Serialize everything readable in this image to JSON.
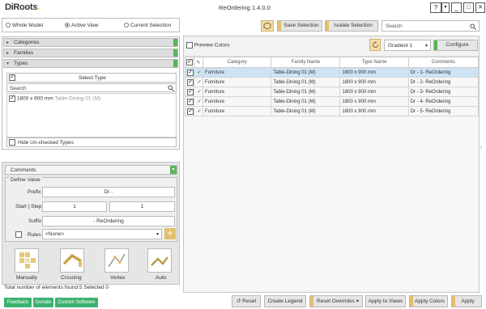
{
  "app": {
    "logo_main": "DiRoots",
    "logo_dot": ".",
    "title": "ReOrdering 1.4.0.0"
  },
  "window_buttons": {
    "help": "?",
    "menu": "▾",
    "minimize": "_",
    "maximize": "□",
    "close": "✕"
  },
  "scope": {
    "options": [
      "Whole Model",
      "Active View",
      "Current Selection"
    ],
    "selected": "Active View"
  },
  "toolbar": {
    "save_selection": "Save Selection",
    "isolate_selection": "Isolate Selection",
    "search_placeholder": "Search"
  },
  "filters": {
    "categories_label": "Categories",
    "families_label": "Families",
    "types_label": "Types",
    "select_type_label": "Select Type",
    "search_placeholder": "Search",
    "types": [
      {
        "name": "1800 x 900 mm",
        "family": "Table-Dining 01 (M)",
        "checked": true
      }
    ],
    "hide_unchecked_label": "Hide Un-checked Types"
  },
  "parameter": {
    "selected": "Comments",
    "define_value_label": "Define Value",
    "prefix_label": "Prefix",
    "prefix_value": "Dr -",
    "start_step_label": "Start | Step",
    "start_value": "1",
    "step_value": "1",
    "suffix_label": "Suffix",
    "suffix_value": "- ReOrdering",
    "rules_label": "Rules",
    "rules_value": "<None>",
    "add_rule": "+"
  },
  "modes": [
    {
      "label": "Manually"
    },
    {
      "label": "Crossing"
    },
    {
      "label": "Vertex"
    },
    {
      "label": "Auto"
    }
  ],
  "preview": {
    "preview_colors_label": "Preview Colors",
    "gradient_value": "Gradient 1",
    "configure_label": "Configure"
  },
  "table": {
    "columns": [
      "Category",
      "Family Name",
      "Type Name",
      "Comments"
    ],
    "rows": [
      {
        "category": "Furniture",
        "family": "Table-Dining 01 (M)",
        "type": "1800 x 900 mm",
        "comments": "Dr - 1- ReOrdering",
        "selected": true
      },
      {
        "category": "Furniture",
        "family": "Table-Dining 01 (M)",
        "type": "1800 x 900 mm",
        "comments": "Dr - 2- ReOrdering",
        "selected": false
      },
      {
        "category": "Furniture",
        "family": "Table-Dining 01 (M)",
        "type": "1800 x 900 mm",
        "comments": "Dr - 3- ReOrdering",
        "selected": false
      },
      {
        "category": "Furniture",
        "family": "Table-Dining 01 (M)",
        "type": "1800 x 900 mm",
        "comments": "Dr - 4- ReOrdering",
        "selected": false
      },
      {
        "category": "Furniture",
        "family": "Table-Dining 01 (M)",
        "type": "1800 x 900 mm",
        "comments": "Dr - 5- ReOrdering",
        "selected": false
      }
    ]
  },
  "status": {
    "found_label": "Total number of elements found",
    "found_count": "5",
    "selected_label": "Selected",
    "selected_count": "0"
  },
  "footer": {
    "feedback": "Feedback",
    "donate": "Donate",
    "custom_software": "Custom Software",
    "reset": "Reset",
    "create_legend": "Create Legend",
    "reset_overrides": "Reset Overrides",
    "apply_to_views": "Apply to Views",
    "apply_colors": "Apply Colors",
    "apply": "Apply"
  },
  "colors": {
    "accent_green": "#5ab559",
    "accent_gold": "#e3c06f",
    "row_selected": "#cde3f5",
    "footer_green": "#3db270"
  }
}
